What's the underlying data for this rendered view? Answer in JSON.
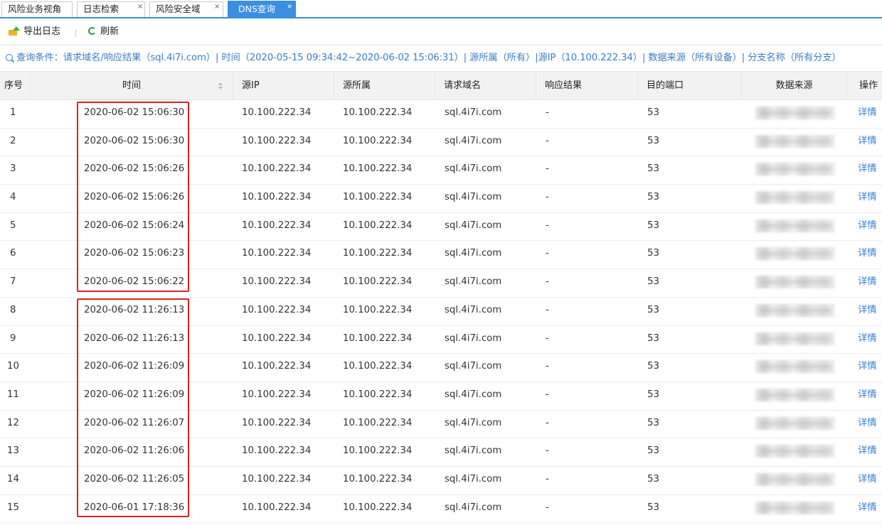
{
  "tabs": [
    {
      "label": "风险业务视角",
      "closable": false,
      "active": false
    },
    {
      "label": "日志检索",
      "closable": true,
      "active": false
    },
    {
      "label": "风险安全域",
      "closable": true,
      "active": false
    },
    {
      "label": "DNS查询",
      "closable": true,
      "active": true
    }
  ],
  "tab_close_glyph": "×",
  "toolbar": {
    "export_label": "导出日志",
    "refresh_label": "刷新"
  },
  "query": {
    "text": "查询条件：请求域名/响应结果（sql.4i7i.com）| 时间（2020-05-15 09:34:42~2020-06-02 15:06:31）| 源所属（所有）|源IP（10.100.222.34）| 数据来源（所有设备）| 分支名称（所有分支）"
  },
  "table": {
    "columns": [
      "序号",
      "时间",
      "源IP",
      "源所属",
      "请求域名",
      "响应结果",
      "目的端口",
      "数据来源",
      "操作"
    ],
    "rows": [
      {
        "no": "1",
        "time": "2020-06-02 15:06:30",
        "src_ip": "10.100.222.34",
        "src_owner": "10.100.222.34",
        "domain": "sql.4i7i.com",
        "response": "-",
        "port": "53",
        "action": "详情"
      },
      {
        "no": "2",
        "time": "2020-06-02 15:06:30",
        "src_ip": "10.100.222.34",
        "src_owner": "10.100.222.34",
        "domain": "sql.4i7i.com",
        "response": "-",
        "port": "53",
        "action": "详情"
      },
      {
        "no": "3",
        "time": "2020-06-02 15:06:26",
        "src_ip": "10.100.222.34",
        "src_owner": "10.100.222.34",
        "domain": "sql.4i7i.com",
        "response": "-",
        "port": "53",
        "action": "详情"
      },
      {
        "no": "4",
        "time": "2020-06-02 15:06:26",
        "src_ip": "10.100.222.34",
        "src_owner": "10.100.222.34",
        "domain": "sql.4i7i.com",
        "response": "-",
        "port": "53",
        "action": "详情"
      },
      {
        "no": "5",
        "time": "2020-06-02 15:06:24",
        "src_ip": "10.100.222.34",
        "src_owner": "10.100.222.34",
        "domain": "sql.4i7i.com",
        "response": "-",
        "port": "53",
        "action": "详情"
      },
      {
        "no": "6",
        "time": "2020-06-02 15:06:23",
        "src_ip": "10.100.222.34",
        "src_owner": "10.100.222.34",
        "domain": "sql.4i7i.com",
        "response": "-",
        "port": "53",
        "action": "详情"
      },
      {
        "no": "7",
        "time": "2020-06-02 15:06:22",
        "src_ip": "10.100.222.34",
        "src_owner": "10.100.222.34",
        "domain": "sql.4i7i.com",
        "response": "-",
        "port": "53",
        "action": "详情"
      },
      {
        "no": "8",
        "time": "2020-06-02 11:26:13",
        "src_ip": "10.100.222.34",
        "src_owner": "10.100.222.34",
        "domain": "sql.4i7i.com",
        "response": "-",
        "port": "53",
        "action": "详情"
      },
      {
        "no": "9",
        "time": "2020-06-02 11:26:13",
        "src_ip": "10.100.222.34",
        "src_owner": "10.100.222.34",
        "domain": "sql.4i7i.com",
        "response": "-",
        "port": "53",
        "action": "详情"
      },
      {
        "no": "10",
        "time": "2020-06-02 11:26:09",
        "src_ip": "10.100.222.34",
        "src_owner": "10.100.222.34",
        "domain": "sql.4i7i.com",
        "response": "-",
        "port": "53",
        "action": "详情"
      },
      {
        "no": "11",
        "time": "2020-06-02 11:26:09",
        "src_ip": "10.100.222.34",
        "src_owner": "10.100.222.34",
        "domain": "sql.4i7i.com",
        "response": "-",
        "port": "53",
        "action": "详情"
      },
      {
        "no": "12",
        "time": "2020-06-02 11:26:07",
        "src_ip": "10.100.222.34",
        "src_owner": "10.100.222.34",
        "domain": "sql.4i7i.com",
        "response": "-",
        "port": "53",
        "action": "详情"
      },
      {
        "no": "13",
        "time": "2020-06-02 11:26:06",
        "src_ip": "10.100.222.34",
        "src_owner": "10.100.222.34",
        "domain": "sql.4i7i.com",
        "response": "-",
        "port": "53",
        "action": "详情"
      },
      {
        "no": "14",
        "time": "2020-06-02 11:26:05",
        "src_ip": "10.100.222.34",
        "src_owner": "10.100.222.34",
        "domain": "sql.4i7i.com",
        "response": "-",
        "port": "53",
        "action": "详情"
      },
      {
        "no": "15",
        "time": "2020-06-01 17:18:36",
        "src_ip": "10.100.222.34",
        "src_owner": "10.100.222.34",
        "domain": "sql.4i7i.com",
        "response": "-",
        "port": "53",
        "action": "详情"
      }
    ]
  },
  "colors": {
    "accent": "#3a8fe0",
    "link": "#2f7fd8",
    "highlight_border": "#e02020",
    "header_bg": "#f2f2f2"
  }
}
